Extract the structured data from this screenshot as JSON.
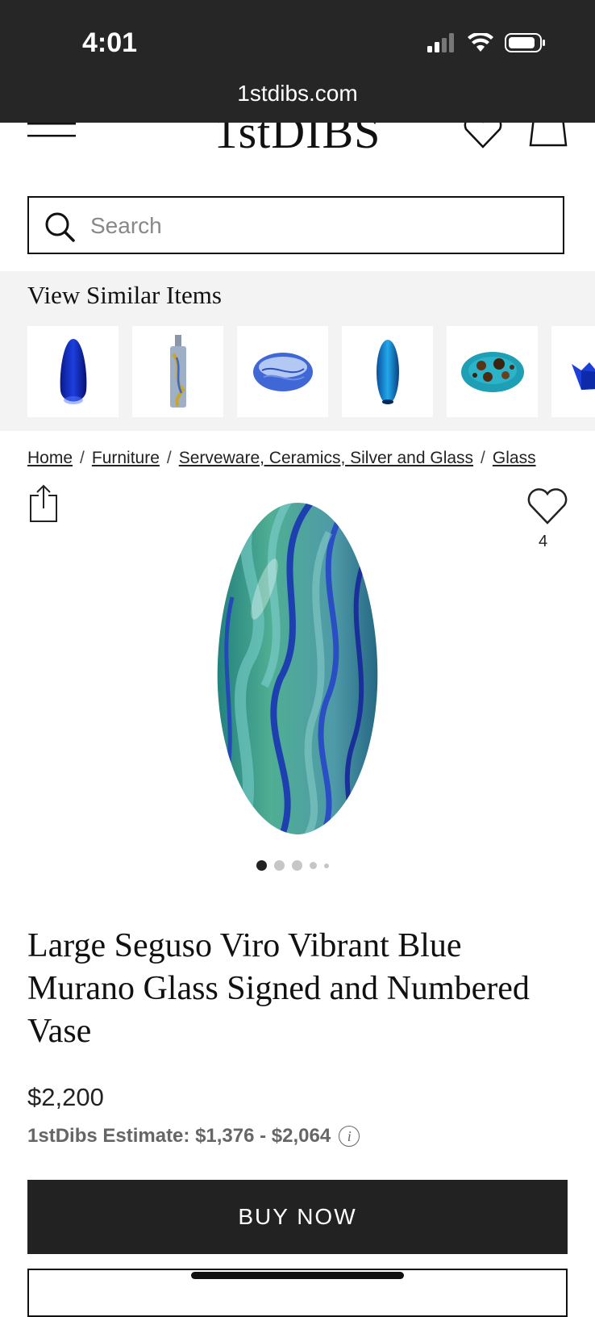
{
  "status_bar": {
    "time": "4:01",
    "url": "1stdibs.com",
    "icons": [
      "signal-icon",
      "wifi-icon",
      "battery-icon"
    ]
  },
  "header": {
    "logo": "1stDIBS",
    "icons": [
      "menu-icon",
      "heart-icon",
      "bag-icon"
    ]
  },
  "search": {
    "placeholder": "Search",
    "value": ""
  },
  "similar": {
    "title": "View Similar Items",
    "items": [
      "blue-teardrop-vase",
      "slim-bottle-vase",
      "blue-glass-bowl",
      "aqua-oval-vase",
      "speckled-glass-bowl",
      "blue-ruffled-bowl"
    ]
  },
  "breadcrumb": {
    "items": [
      "Home",
      "Furniture",
      "Serveware, Ceramics, Silver and Glass",
      "Glass"
    ],
    "separator": "/"
  },
  "product": {
    "favorite_count": "4",
    "image_count": 5,
    "active_image": 1,
    "title": "Large Seguso Viro Vibrant Blue Murano Glass Signed and Numbered Vase",
    "price": "$2,200",
    "estimate": "1stDibs Estimate: $1,376 - $2,064",
    "buy_label": "BUY NOW"
  },
  "colors": {
    "status_bg": "#262626",
    "button_bg": "#222222",
    "similar_bg": "#f3f3f3"
  }
}
